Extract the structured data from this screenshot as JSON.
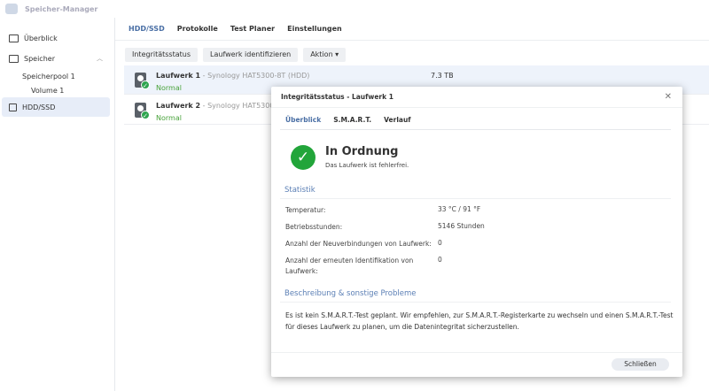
{
  "app": {
    "title": "Speicher-Manager"
  },
  "sidebar": {
    "items": [
      {
        "label": "Überblick"
      },
      {
        "label": "Speicher"
      },
      {
        "label": "Speicherpool 1"
      },
      {
        "label": "Volume 1"
      },
      {
        "label": "HDD/SSD"
      }
    ]
  },
  "tabs": [
    "HDD/SSD",
    "Protokolle",
    "Test Planer",
    "Einstellungen"
  ],
  "toolbar": {
    "integrity": "Integritätsstatus",
    "identify": "Laufwerk identifizieren",
    "action": "Aktion ▾"
  },
  "drives": [
    {
      "name": "Laufwerk 1",
      "model": " - Synology HAT5300-8T (HDD)",
      "status": "Normal",
      "size": "7.3 TB"
    },
    {
      "name": "Laufwerk 2",
      "model": " - Synology HAT5300-8T (HDD)",
      "status": "Normal"
    }
  ],
  "dialog": {
    "title": "Integritätsstatus - Laufwerk 1",
    "tabs": [
      "Überblick",
      "S.M.A.R.T.",
      "Verlauf"
    ],
    "status_title": "In Ordnung",
    "status_sub": "Das Laufwerk ist fehlerfrei.",
    "stats_heading": "Statistik",
    "stats": [
      {
        "label": "Temperatur:",
        "value": "33 °C / 91 °F"
      },
      {
        "label": "Betriebsstunden:",
        "value": "5146 Stunden"
      },
      {
        "label": "Anzahl der Neuverbindungen von Laufwerk:",
        "value": "0"
      },
      {
        "label": "Anzahl der erneuten Identifikation von Laufwerk:",
        "value": "0"
      }
    ],
    "desc_heading": "Beschreibung & sonstige Probleme",
    "desc": "Es ist kein S.M.A.R.T.-Test geplant. Wir empfehlen, zur S.M.A.R.T.-Registerkarte zu wechseln und einen S.M.A.R.T.-Test für dieses Laufwerk zu planen, um die Datenintegritat sicherzustellen.",
    "close": "Schließen"
  },
  "colors": {
    "accent": "#4a6fa5",
    "ok": "#22a53a",
    "selected_row": "#eef3fb"
  }
}
